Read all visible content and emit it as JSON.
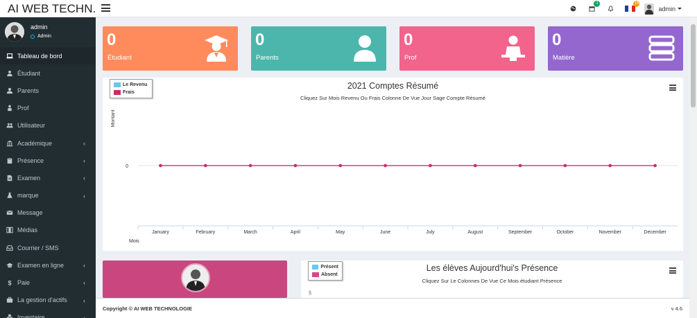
{
  "header": {
    "brand": "AI WEB TECHN..",
    "calendar_badge": "1",
    "flag_badge": "15",
    "user_label": "admin"
  },
  "sidebar": {
    "user_name": "admin",
    "user_role": "Admin",
    "items": [
      {
        "label": "Tableau de bord",
        "icon": "laptop-icon",
        "active": true,
        "has_children": false
      },
      {
        "label": "Étudiant",
        "icon": "graduate-icon",
        "active": false,
        "has_children": false
      },
      {
        "label": "Parents",
        "icon": "user-icon",
        "active": false,
        "has_children": false
      },
      {
        "label": "Prof",
        "icon": "teacher-icon",
        "active": false,
        "has_children": false
      },
      {
        "label": "Utilisateur",
        "icon": "users-icon",
        "active": false,
        "has_children": false
      },
      {
        "label": "Académique",
        "icon": "university-icon",
        "active": false,
        "has_children": true
      },
      {
        "label": "Présence",
        "icon": "clipboard-icon",
        "active": false,
        "has_children": true
      },
      {
        "label": "Examen",
        "icon": "document-icon",
        "active": false,
        "has_children": true
      },
      {
        "label": "marque",
        "icon": "flask-icon",
        "active": false,
        "has_children": true
      },
      {
        "label": "Message",
        "icon": "envelope-icon",
        "active": false,
        "has_children": false
      },
      {
        "label": "Médias",
        "icon": "film-icon",
        "active": false,
        "has_children": false
      },
      {
        "label": "Courrier / SMS",
        "icon": "inbox-icon",
        "active": false,
        "has_children": false
      },
      {
        "label": "Examen en ligne",
        "icon": "graduation-cap-icon",
        "active": false,
        "has_children": true
      },
      {
        "label": "Paie",
        "icon": "dollar-icon",
        "active": false,
        "has_children": true
      },
      {
        "label": "La gestion d'actifs",
        "icon": "briefcase-icon",
        "active": false,
        "has_children": true
      },
      {
        "label": "Inventaire",
        "icon": "cubes-icon",
        "active": false,
        "has_children": true
      }
    ]
  },
  "stats": [
    {
      "value": "0",
      "label": "Étudiant",
      "color": "#ff8b5d",
      "icon": "graduate-icon"
    },
    {
      "value": "0",
      "label": "Parents",
      "color": "#4cb6ac",
      "icon": "user-icon"
    },
    {
      "value": "0",
      "label": "Prof",
      "color": "#f2648c",
      "icon": "teacher-icon"
    },
    {
      "value": "0",
      "label": "Matière",
      "color": "#9467cf",
      "icon": "books-icon"
    }
  ],
  "chart_data": {
    "type": "line",
    "title": "2021 Comptes Résumé",
    "subtitle": "Cliquez Sur Mois Revenu Ou Frais Colonne De Vue Jour Sage Compte Résumé",
    "xlabel": "Mois",
    "ylabel": "Montant",
    "categories": [
      "January",
      "February",
      "March",
      "April",
      "May",
      "June",
      "July",
      "August",
      "September",
      "October",
      "November",
      "December"
    ],
    "yticks": [
      "0"
    ],
    "series": [
      {
        "name": "Le Revenu",
        "color": "#66c8ec",
        "values": [
          0,
          0,
          0,
          0,
          0,
          0,
          0,
          0,
          0,
          0,
          0,
          0
        ]
      },
      {
        "name": "Frais",
        "color": "#cf2a67",
        "values": [
          0,
          0,
          0,
          0,
          0,
          0,
          0,
          0,
          0,
          0,
          0,
          0
        ]
      }
    ],
    "legend": "top-left"
  },
  "attendance": {
    "title": "Les élèves Aujourd'hui's Présence",
    "subtitle": "Cliquez Sur Le Colonnes De Vue Ce Mois étudiant Présence",
    "legend": [
      {
        "name": "Présent",
        "color": "#66c8ec"
      },
      {
        "name": "Absent",
        "color": "#d6468a"
      }
    ],
    "axis_glyph": "§"
  },
  "profile_card": {
    "color": "#c9477e"
  },
  "footer": {
    "copyright": "Copyright © AI WEB TECHNOLOGIE",
    "version": "v 4.6"
  }
}
